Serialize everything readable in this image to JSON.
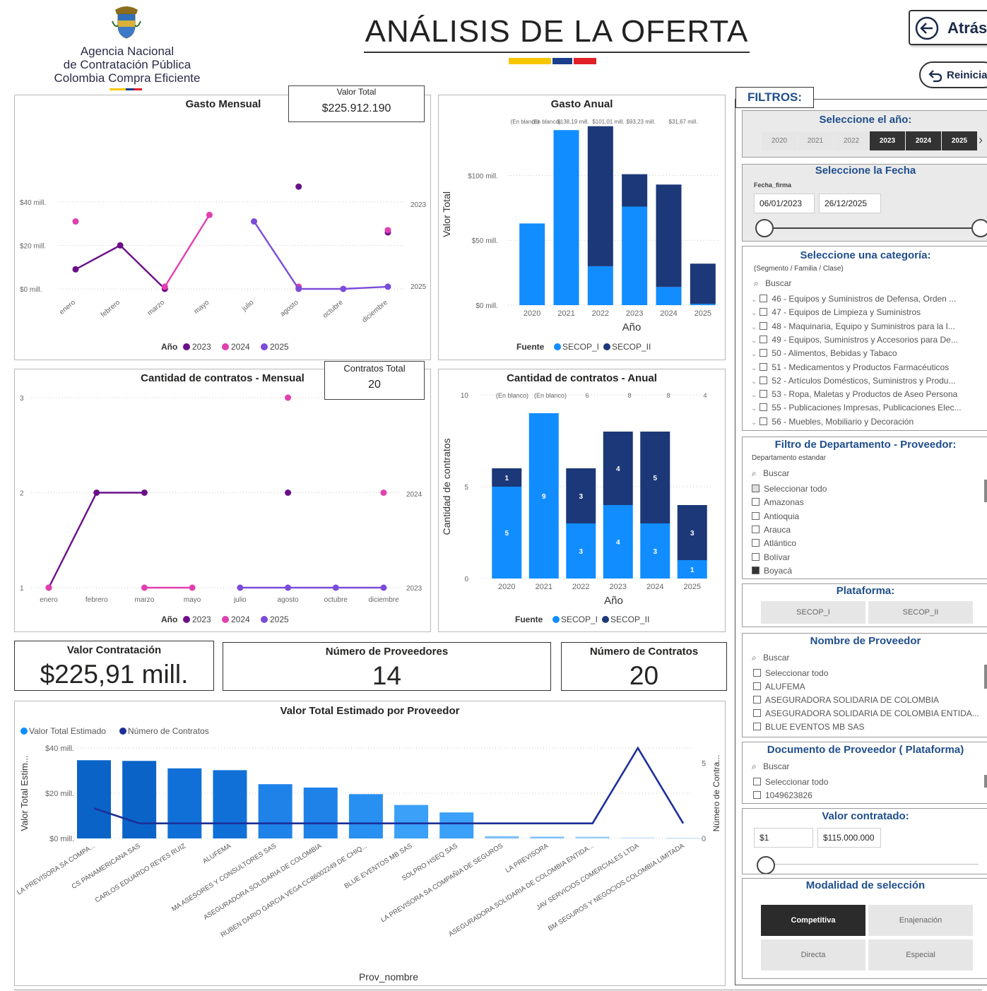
{
  "header": {
    "org_line1": "Agencia Nacional",
    "org_line2": "de Contratación Pública",
    "org_line3": "Colombia Compra Eficiente",
    "title": "ANÁLISIS DE LA OFERTA",
    "back_label": "Atrás",
    "reset_label": "Reinicia",
    "back_icon": "back-arrow-icon",
    "reset_icon": "reset-icon"
  },
  "colors": {
    "y2023": "#6b0f89",
    "y2024": "#e040b0",
    "y2025": "#7b4cd9",
    "secop1": "#118dff",
    "secop2": "#1c3878",
    "flag_yellow": "#f7c600",
    "flag_blue": "#1a3e8c",
    "flag_red": "#e01f26"
  },
  "kpis": {
    "valor_total_label": "Valor Total",
    "valor_total_value": "$225.912.190",
    "contratos_total_label": "Contratos Total",
    "contratos_total_value": "20",
    "valor_contratacion_label": "Valor Contratación",
    "valor_contratacion_value": "$225,91 mill.",
    "num_proveedores_label": "Número de Proveedores",
    "num_proveedores_value": "14",
    "num_contratos_label": "Número de Contratos",
    "num_contratos_value": "20"
  },
  "legends": {
    "anio_label": "Año",
    "y2023": "2023",
    "y2024": "2024",
    "y2025": "2025",
    "fuente_label": "Fuente",
    "secop1": "SECOP_I",
    "secop2": "SECOP_II",
    "valor_total_estimado": "Valor Total Estimado",
    "numero_contratos": "Número de Contratos"
  },
  "chart_data": [
    {
      "id": "gasto_mensual",
      "type": "line",
      "title": "Gasto Mensual",
      "categories": [
        "enero",
        "febrero",
        "marzo",
        "mayo",
        "julio",
        "agosto",
        "octubre",
        "diciembre"
      ],
      "yticks": [
        "$0 mill.",
        "$20 mill.",
        "$40 mill."
      ],
      "ylim": [
        0,
        50
      ],
      "series": [
        {
          "name": "2023",
          "values": [
            9,
            20,
            0,
            null,
            null,
            47,
            null,
            26
          ]
        },
        {
          "name": "2024",
          "values": [
            31,
            null,
            1,
            34,
            null,
            1,
            null,
            27
          ]
        },
        {
          "name": "2025",
          "values": [
            null,
            null,
            null,
            null,
            31,
            0,
            0,
            1
          ]
        }
      ],
      "end_labels": [
        "2023",
        "2025"
      ]
    },
    {
      "id": "gasto_anual",
      "type": "bar",
      "title": "Gasto Anual",
      "xlabel": "Año",
      "ylabel": "Valor Total",
      "categories": [
        "2020",
        "2021",
        "2022",
        "2023",
        "2024",
        "2025"
      ],
      "yticks": [
        "$0 mill.",
        "$50 mill.",
        "$100 mill."
      ],
      "ylim": [
        0,
        140
      ],
      "top_labels": [
        "(En blanco)",
        "(En blanco)",
        "$138,19 mill.",
        "$101,01 mill.",
        "$93,23 mill.",
        "$31,67 mill."
      ],
      "series": [
        {
          "name": "SECOP_I",
          "values": [
            63,
            135,
            30,
            76,
            14,
            1
          ]
        },
        {
          "name": "SECOP_II",
          "values": [
            0,
            0,
            108,
            25,
            79,
            31
          ]
        }
      ]
    },
    {
      "id": "cantidad_mensual",
      "type": "line",
      "title": "Cantidad de contratos - Mensual",
      "categories": [
        "enero",
        "febrero",
        "marzo",
        "mayo",
        "julio",
        "agosto",
        "octubre",
        "diciembre"
      ],
      "yticks": [
        "1",
        "2",
        "3"
      ],
      "ylim": [
        1,
        3
      ],
      "series": [
        {
          "name": "2023",
          "values": [
            1,
            2,
            2,
            null,
            null,
            2,
            null,
            null
          ]
        },
        {
          "name": "2024",
          "values": [
            1,
            null,
            1,
            1,
            null,
            3,
            null,
            2
          ]
        },
        {
          "name": "2025",
          "values": [
            null,
            null,
            null,
            null,
            1,
            1,
            1,
            1
          ]
        }
      ],
      "end_labels": [
        "2024",
        "2023"
      ]
    },
    {
      "id": "cantidad_anual",
      "type": "bar",
      "title": "Cantidad de contratos - Anual",
      "xlabel": "Año",
      "ylabel": "Cantidad de contratos",
      "categories": [
        "2020",
        "2021",
        "2022",
        "2023",
        "2024",
        "2025"
      ],
      "yticks": [
        "0",
        "5",
        "10"
      ],
      "ylim": [
        0,
        10
      ],
      "top_labels": [
        "(En blanco)",
        "(En blanco)",
        "6",
        "8",
        "8",
        "4"
      ],
      "series": [
        {
          "name": "SECOP_I",
          "values": [
            5,
            9,
            3,
            4,
            3,
            1
          ]
        },
        {
          "name": "SECOP_II",
          "values": [
            1,
            0,
            3,
            4,
            5,
            3
          ]
        }
      ]
    },
    {
      "id": "valor_por_proveedor",
      "type": "bar",
      "title": "Valor Total Estimado por Proveedor",
      "xlabel": "Prov_nombre",
      "ylabel": "Valor Total Estim...",
      "y2label": "Número de Contra...",
      "yticks": [
        "$0 mill.",
        "$20 mill.",
        "$40 mill."
      ],
      "y2ticks": [
        "0",
        "5"
      ],
      "ylim": [
        0,
        40
      ],
      "y2lim": [
        0,
        6
      ],
      "categories": [
        "LA PREVISORA SA COMPA...",
        "CS PANAMERICANA SAS",
        "CARLOS EDUARDO REYES RUIZ",
        "ALUFEMA",
        "MA ASESORES Y CONSULTORES SAS",
        "ASEGURADORA SOLIDARIA DE COLOMBIA",
        "RUBEN DARIO GARCIA VEGA CC86002249 DE CHIQ...",
        "BLUE EVENTOS MB SAS",
        "SOLPRO HSEQ SAS",
        "LA PREVISORA SA COMPAÑIA DE SEGUROS",
        "LA PREVISORA",
        "ASEGURADORA SOLIDARIA DE COLOMBIA ENTIDA...",
        "JAV SERVICIOS COMERCIALES LTDA",
        "BM SEGUROS Y NEGOCIOS COLOMBIA LIMITADA"
      ],
      "values": [
        34.6,
        34.3,
        31.0,
        30.2,
        24.0,
        22.5,
        19.6,
        14.8,
        11.5,
        1.0,
        0.8,
        0.8,
        0.4,
        0.3
      ],
      "line_values": [
        2,
        1,
        1,
        1,
        1,
        1,
        1,
        1,
        1,
        1,
        1,
        1,
        6,
        1
      ]
    }
  ],
  "filters": {
    "title": "FILTROS:",
    "year": {
      "title": "Seleccione el año:",
      "options": [
        "2020",
        "2021",
        "2022",
        "2023",
        "2024",
        "2025"
      ],
      "selected": [
        "2023",
        "2024",
        "2025"
      ],
      "next_icon": "chevron-right-icon"
    },
    "date": {
      "title": "Seleccione la Fecha",
      "field_label": "Fecha_firma",
      "from": "06/01/2023",
      "to": "26/12/2025"
    },
    "category": {
      "title": "Seleccione una categoría:",
      "subtitle": "(Segmento / Familia / Clase)",
      "search_placeholder": "Buscar",
      "items": [
        "46 - Equipos y Suministros de Defensa, Orden ...",
        "47 - Equipos de Limpieza y Suministros",
        "48 - Maquinaria, Equipo y Suministros para la I...",
        "49 - Equipos, Suministros y Accesorios para De...",
        "50 - Alimentos, Bebidas y Tabaco",
        "51 - Medicamentos y Productos Farmacéuticos",
        "52 - Artículos Domésticos, Suministros y Produ...",
        "53 - Ropa, Maletas y Productos de Aseo Persona",
        "55 - Publicaciones Impresas, Publicaciones Elec...",
        "56 - Muebles, Mobiliario y Decoración"
      ]
    },
    "department": {
      "title": "Filtro de Departamento - Proveedor:",
      "field_label": "Departamento estandar",
      "search_placeholder": "Buscar",
      "items": [
        "Seleccionar todo",
        "Amazonas",
        "Antioquia",
        "Arauca",
        "Atlántico",
        "Bolívar",
        "Boyacá"
      ],
      "checked": [
        "Boyacá"
      ]
    },
    "platform": {
      "title": "Plataforma:",
      "options": [
        "SECOP_I",
        "SECOP_II"
      ]
    },
    "provider_name": {
      "title": "Nombre de Proveedor",
      "search_placeholder": "Buscar",
      "items": [
        "Seleccionar todo",
        "ALUFEMA",
        "ASEGURADORA SOLIDARIA DE COLOMBIA",
        "ASEGURADORA SOLIDARIA DE COLOMBIA ENTIDA...",
        "BLUE EVENTOS MB SAS"
      ]
    },
    "provider_doc": {
      "title": "Documento de Proveedor ( Plataforma)",
      "search_placeholder": "Buscar",
      "items": [
        "Seleccionar todo",
        "1049623826"
      ]
    },
    "value": {
      "title": "Valor contratado:",
      "min": "$1",
      "max": "$115.000.000"
    },
    "modality": {
      "title": "Modalidad de selección",
      "options": [
        "Competitiva",
        "Enajenación",
        "Directa",
        "Especial"
      ],
      "selected": "Competitiva"
    }
  }
}
